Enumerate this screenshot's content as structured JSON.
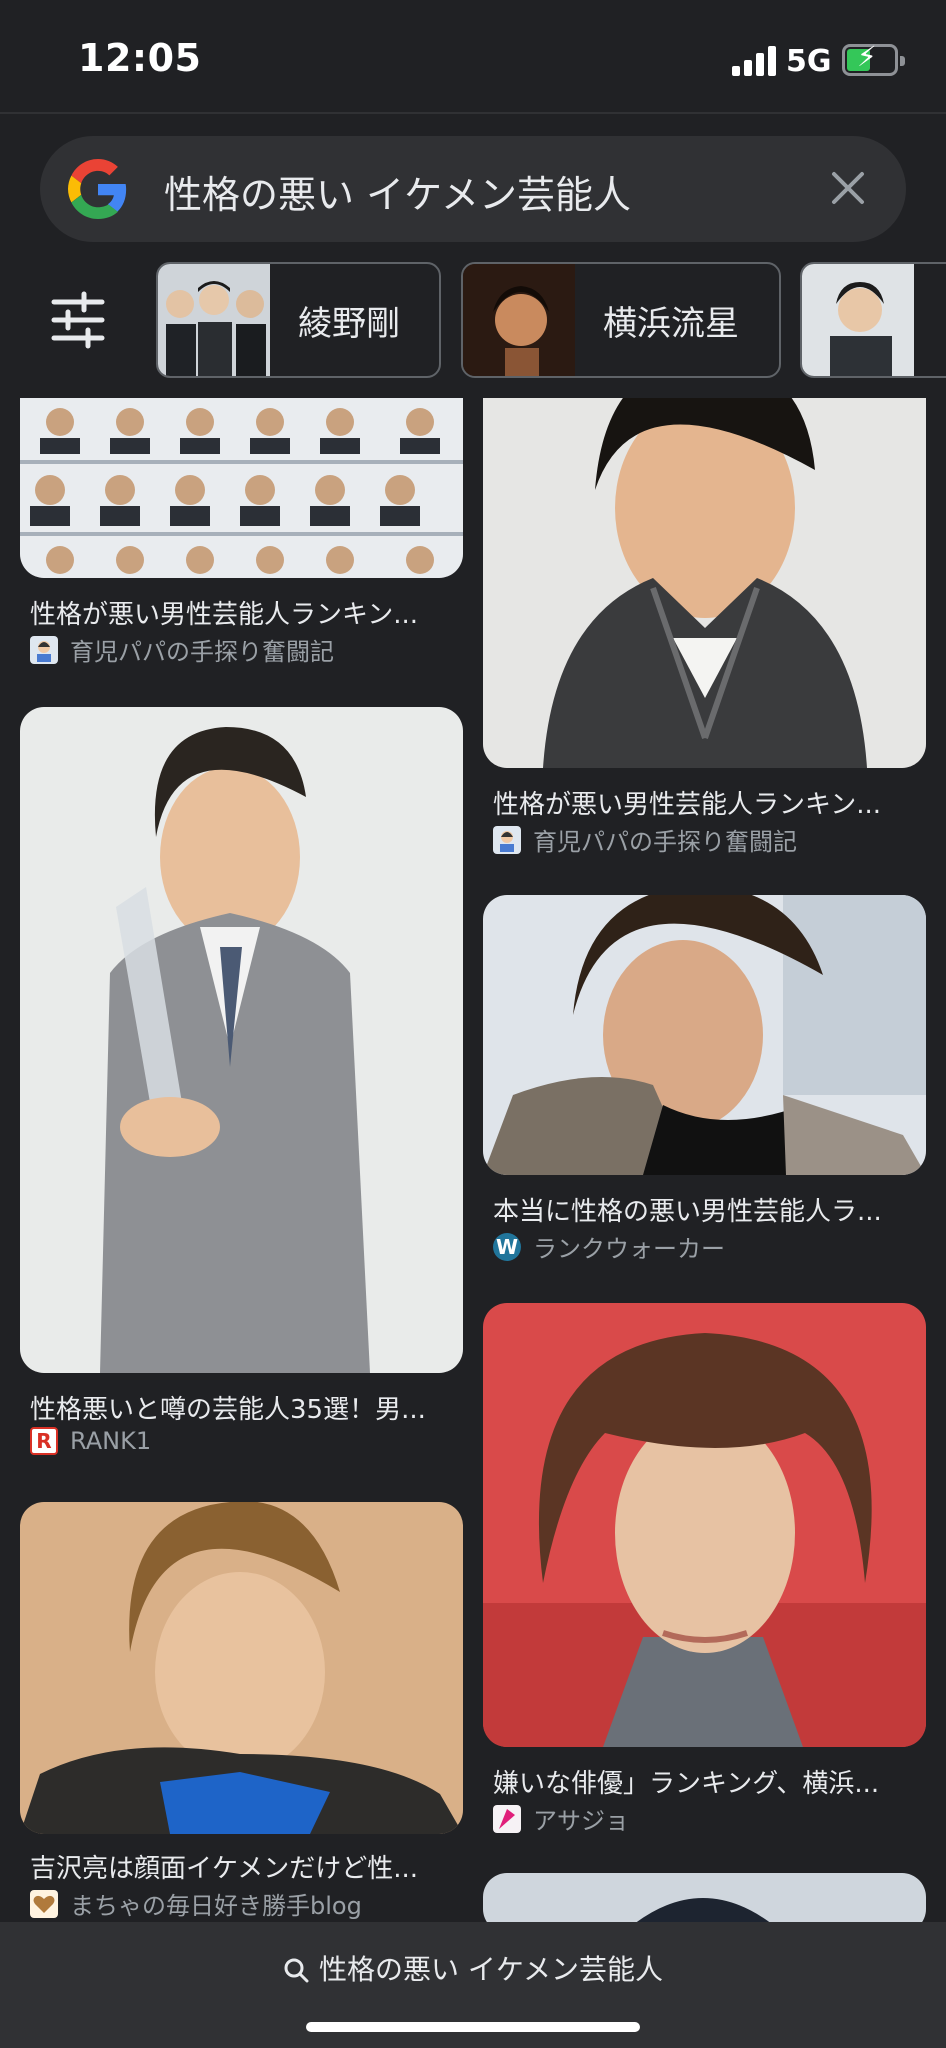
{
  "status_bar": {
    "time": "12:05",
    "network": "5G",
    "battery_fill": 0.45
  },
  "search": {
    "query": "性格の悪い イケメン芸能人"
  },
  "chips": [
    {
      "label": "綾野剛",
      "thumb_icon": "group-photo"
    },
    {
      "label": "横浜流星",
      "thumb_icon": "portrait-photo"
    },
    {
      "label": "",
      "thumb_icon": "portrait-photo"
    }
  ],
  "results": [
    {
      "title": "性格が悪い男性芸能人ランキン...",
      "source": "育児パパの手探り奮闘記",
      "favicon": "avatar-icon"
    },
    {
      "title": "性格が悪い男性芸能人ランキン...",
      "source": "育児パパの手探り奮闘記",
      "favicon": "avatar-icon"
    },
    {
      "title": "性格悪いと噂の芸能人35選！男...",
      "source": "RANK1",
      "favicon": "R"
    },
    {
      "title": "本当に性格の悪い男性芸能人ラ...",
      "source": "ランクウォーカー",
      "favicon": "wordpress-icon"
    },
    {
      "title": "吉沢亮は顔面イケメンだけど性...",
      "source": "まちゃの毎日好き勝手blog",
      "favicon": "heart-icon"
    },
    {
      "title": "嫌いな俳優」ランキング、横浜...",
      "source": "アサジョ",
      "favicon": "brand-icon"
    }
  ],
  "bottom_bar": {
    "query": "性格の悪い イケメン芸能人"
  },
  "colors": {
    "background": "#202124",
    "surface": "#303134",
    "text": "#e8eaed",
    "muted": "#9aa0a6"
  }
}
